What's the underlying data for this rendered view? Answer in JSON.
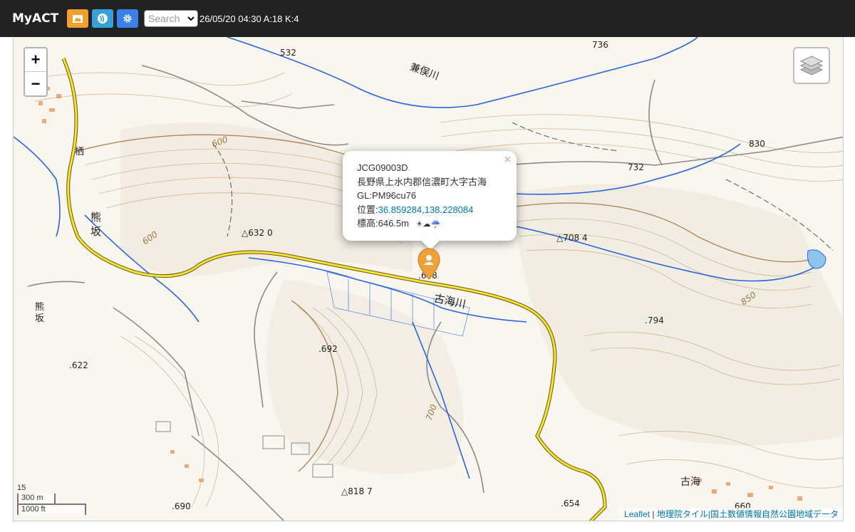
{
  "app": {
    "title": "MyACT"
  },
  "navbar": {
    "buttons": [
      {
        "name": "spots-button",
        "icon": "mountain-icon",
        "color": "#f0a030"
      },
      {
        "name": "signal-button",
        "icon": "signal-icon",
        "color": "#38a0d8"
      },
      {
        "name": "settings-button",
        "icon": "gear-icon",
        "color": "#3a80e8"
      }
    ],
    "search": {
      "placeholder": "Search"
    },
    "status": "26/05/20 04:30 A:18 K:4"
  },
  "map": {
    "labels": {
      "contour_600_a": "600",
      "contour_600_b": "600",
      "contour_700": "700",
      "contour_850": "850",
      "river_kaneho": "兼俣川",
      "river_furumi": "古海川",
      "place_kumasaka": "熊坂",
      "place_kumasaka2": "熊\n坂",
      "place_furumi": "古海",
      "place_kuri": "栖",
      "elev_532": "532",
      "elev_736": "736",
      "elev_830": "830",
      "elev_732": "732",
      "elev_632": "△632 0",
      "elev_708": "△708 4",
      "elev_648": ".648",
      "elev_794": ".794",
      "elev_692": ".692",
      "elev_622": ".622",
      "elev_818": "△818 7",
      "elev_690": ".690",
      "elev_654": ".654",
      "elev_660": ".660"
    },
    "zoom": {
      "in_label": "+",
      "out_label": "−"
    },
    "popup": {
      "close_label": "×",
      "id": "JCG09003D",
      "address": "長野県上水内郡信濃町大字古海",
      "grid": "GL:PM96cu76",
      "position_label": "位置:",
      "position_value": "36.859284,138.228084",
      "elevation": "標高:646.5m",
      "weather_icons": "☀☁☔"
    },
    "scale": {
      "zoom_level": "15",
      "metric": "300 m",
      "imperial": "1000 ft"
    },
    "attribution": {
      "leaflet": "Leaflet",
      "separator": " | ",
      "sources": "地理院タイル|国土数値情報自然公園地域データ"
    }
  }
}
